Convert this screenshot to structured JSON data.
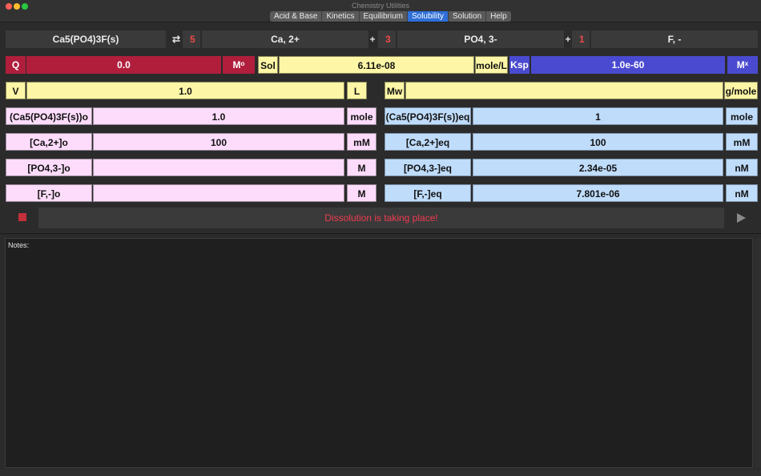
{
  "window": {
    "title": "Chemistry Utilities"
  },
  "tabs": [
    {
      "label": "Acid & Base"
    },
    {
      "label": "Kinetics"
    },
    {
      "label": "Equilibrium"
    },
    {
      "label": "Solubility",
      "active": true
    },
    {
      "label": "Solution"
    },
    {
      "label": "Help"
    }
  ],
  "reaction": {
    "reactant": "Ca5(PO4)3F(s)",
    "arrow": "⇄",
    "coef1": "5",
    "product1": "Ca, 2+",
    "plus1": "+",
    "coef2": "3",
    "product2": "PO4, 3-",
    "plus2": "+",
    "coef3": "1",
    "product3": "F, -"
  },
  "row_q": {
    "q_label": "Q",
    "q_value": "0.0",
    "q_unit": "Mᵒ",
    "sol_label": "Sol",
    "sol_value": "6.11e-08",
    "sol_unit": "mole/L",
    "ksp_label": "Ksp",
    "ksp_value": "1.0e-60",
    "ksp_unit": "Mˣ"
  },
  "row_v": {
    "v_label": "V",
    "v_value": "1.0",
    "v_unit": "L",
    "mw_label": "Mw",
    "mw_value": "",
    "mw_unit": "g/mole"
  },
  "initial": [
    {
      "label": "(Ca5(PO4)3F(s))o",
      "value": "1.0",
      "unit": "mole"
    },
    {
      "label": "[Ca,2+]o",
      "value": "100",
      "unit": "mM"
    },
    {
      "label": "[PO4,3-]o",
      "value": "",
      "unit": "M"
    },
    {
      "label": "[F,-]o",
      "value": "",
      "unit": "M"
    }
  ],
  "equilibrium": [
    {
      "label": "(Ca5(PO4)3F(s))eq",
      "value": "1",
      "unit": "mole"
    },
    {
      "label": "[Ca,2+]eq",
      "value": "100",
      "unit": "mM"
    },
    {
      "label": "[PO4,3-]eq",
      "value": "2.34e-05",
      "unit": "nM"
    },
    {
      "label": "[F,-]eq",
      "value": "7.801e-06",
      "unit": "nM"
    }
  ],
  "status": {
    "message": "Dissolution is taking place!"
  },
  "notes": {
    "label": "Notes:",
    "content": ""
  },
  "colors": {
    "q_red": "#b01e3c",
    "ksp_blue": "#4a4ad0",
    "yellow": "#fdf6a6",
    "pink": "#fddcfb",
    "light_blue": "#bfdcfb",
    "status_red": "#f03c50",
    "accent_tab": "#2e6fd8"
  },
  "icons": [
    "stop-icon",
    "play-icon",
    "exchange-arrow-icon"
  ]
}
